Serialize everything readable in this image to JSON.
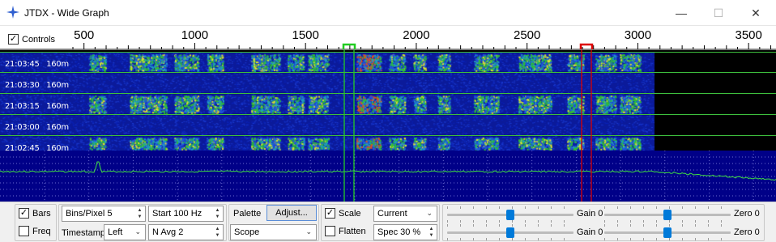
{
  "window": {
    "title": "JTDX - Wide Graph",
    "minimize_glyph": "—",
    "maximize_glyph": "☐",
    "close_glyph": "✕"
  },
  "scale": {
    "controls_label": "Controls",
    "controls_checked": true,
    "tick_labels": [
      "500",
      "1000",
      "1500",
      "2000",
      "2500",
      "3000",
      "3500"
    ],
    "rx_marker_color": "#22cc22",
    "tx_marker_color": "#dd0000"
  },
  "waterfall": {
    "rows": [
      {
        "time": "21:03:45",
        "band": "160m"
      },
      {
        "time": "21:03:30",
        "band": "160m"
      },
      {
        "time": "21:03:15",
        "band": "160m"
      },
      {
        "time": "21:03:00",
        "band": "160m"
      },
      {
        "time": "21:02:45",
        "band": "160m"
      }
    ]
  },
  "controls": {
    "bars_label": "Bars",
    "bars_checked": true,
    "freq_label": "Freq",
    "freq_checked": false,
    "bins_per_pixel": "Bins/Pixel  5",
    "start": "Start 100 Hz",
    "timestamp_label": "Timestamp",
    "timestamp_value": "Left",
    "n_avg": "N Avg 2",
    "palette_label": "Palette",
    "adjust_button": "Adjust...",
    "palette_value": "Scope",
    "scale_label": "Scale",
    "scale_checked": true,
    "flatten_label": "Flatten",
    "flatten_checked": false,
    "spectrum_mode": "Current",
    "spec_percent": "Spec 30 %",
    "gain_top_label": "Gain 0",
    "zero_top_label": "Zero 0",
    "gain_bottom_label": "Gain 0",
    "zero_bottom_label": "Zero 0"
  }
}
